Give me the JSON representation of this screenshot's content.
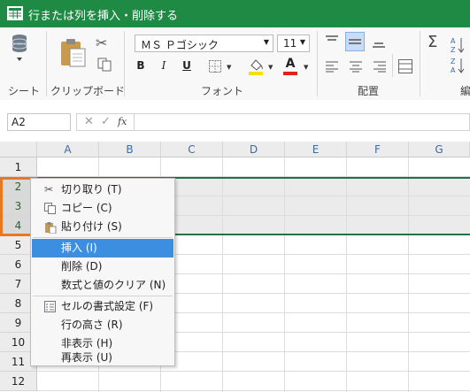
{
  "window": {
    "title": "行または列を挿入・削除する",
    "accent": "#1e8a43"
  },
  "ribbon": {
    "groups": {
      "sheet": "シート",
      "clipboard": "クリップボード",
      "font": "フォント",
      "align": "配置",
      "edit": "編"
    },
    "font_name": "ＭＳ Ｐゴシック",
    "font_size": "11",
    "bold": "B",
    "italic": "I",
    "underline": "U",
    "font_color_letter": "A",
    "sigma": "Σ"
  },
  "formula_bar": {
    "cell_ref": "A2",
    "fx": "fx",
    "value": ""
  },
  "grid": {
    "columns": [
      "A",
      "B",
      "C",
      "D",
      "E",
      "F",
      "G"
    ],
    "rows": [
      "1",
      "2",
      "3",
      "4",
      "5",
      "6",
      "7",
      "8",
      "9",
      "10",
      "11",
      "12"
    ],
    "selected_rows": [
      "2",
      "3",
      "4"
    ]
  },
  "context_menu": {
    "items": [
      {
        "label": "切り取り (T)",
        "icon": "scissors-icon"
      },
      {
        "label": "コピー (C)",
        "icon": "copy-icon"
      },
      {
        "label": "貼り付け (S)",
        "icon": "paste-icon"
      },
      {
        "label": "挿入 (I)",
        "highlighted": true
      },
      {
        "label": "削除 (D)"
      },
      {
        "label": "数式と値のクリア (N)"
      },
      {
        "label": "セルの書式設定 (F)",
        "icon": "format-cells-icon"
      },
      {
        "label": "行の高さ (R)"
      },
      {
        "label": "非表示 (H)"
      },
      {
        "label": "再表示 (U)"
      }
    ],
    "highlight_color": "#3c8fe0"
  },
  "annotation": {
    "highlight_color": "#e87722"
  }
}
